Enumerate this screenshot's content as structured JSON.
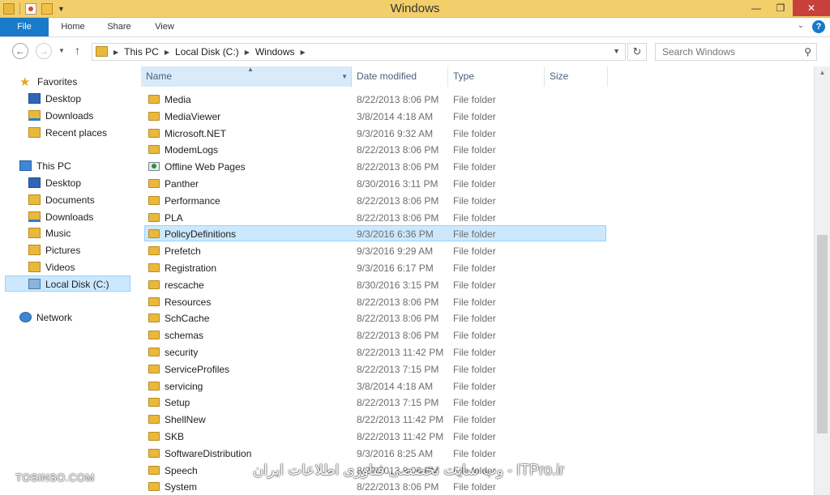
{
  "window": {
    "title": "Windows",
    "controls": {
      "minimize": "—",
      "restore": "❐",
      "close": "✕"
    }
  },
  "ribbon": {
    "tabs": [
      {
        "label": "File"
      },
      {
        "label": "Home"
      },
      {
        "label": "Share"
      },
      {
        "label": "View"
      }
    ],
    "expand_glyph": "⌄",
    "help_glyph": "?"
  },
  "address": {
    "breadcrumbs": [
      "This PC",
      "Local Disk (C:)",
      "Windows"
    ],
    "search_placeholder": "Search Windows"
  },
  "navigation": {
    "favorites": {
      "label": "Favorites",
      "items": [
        {
          "label": "Desktop",
          "icon": "desktop-icon"
        },
        {
          "label": "Downloads",
          "icon": "downloads-icon"
        },
        {
          "label": "Recent places",
          "icon": "recent-places-icon"
        }
      ]
    },
    "this_pc": {
      "label": "This PC",
      "items": [
        {
          "label": "Desktop",
          "icon": "desktop-icon"
        },
        {
          "label": "Documents",
          "icon": "documents-icon"
        },
        {
          "label": "Downloads",
          "icon": "downloads-icon"
        },
        {
          "label": "Music",
          "icon": "music-icon"
        },
        {
          "label": "Pictures",
          "icon": "pictures-icon"
        },
        {
          "label": "Videos",
          "icon": "videos-icon"
        },
        {
          "label": "Local Disk (C:)",
          "icon": "local-disk-icon",
          "selected": true
        }
      ]
    },
    "network": {
      "label": "Network"
    }
  },
  "columns": {
    "name": "Name",
    "date": "Date modified",
    "type": "Type",
    "size": "Size"
  },
  "files": [
    {
      "name": "Media",
      "date": "8/22/2013 8:06 PM",
      "type": "File folder"
    },
    {
      "name": "MediaViewer",
      "date": "3/8/2014 4:18 AM",
      "type": "File folder"
    },
    {
      "name": "Microsoft.NET",
      "date": "9/3/2016 9:32 AM",
      "type": "File folder"
    },
    {
      "name": "ModemLogs",
      "date": "8/22/2013 8:06 PM",
      "type": "File folder"
    },
    {
      "name": "Offline Web Pages",
      "date": "8/22/2013 8:06 PM",
      "type": "File folder",
      "special": true
    },
    {
      "name": "Panther",
      "date": "8/30/2016 3:11 PM",
      "type": "File folder"
    },
    {
      "name": "Performance",
      "date": "8/22/2013 8:06 PM",
      "type": "File folder"
    },
    {
      "name": "PLA",
      "date": "8/22/2013 8:06 PM",
      "type": "File folder"
    },
    {
      "name": "PolicyDefinitions",
      "date": "9/3/2016 6:36 PM",
      "type": "File folder",
      "selected": true
    },
    {
      "name": "Prefetch",
      "date": "9/3/2016 9:29 AM",
      "type": "File folder"
    },
    {
      "name": "Registration",
      "date": "9/3/2016 6:17 PM",
      "type": "File folder"
    },
    {
      "name": "rescache",
      "date": "8/30/2016 3:15 PM",
      "type": "File folder"
    },
    {
      "name": "Resources",
      "date": "8/22/2013 8:06 PM",
      "type": "File folder"
    },
    {
      "name": "SchCache",
      "date": "8/22/2013 8:06 PM",
      "type": "File folder"
    },
    {
      "name": "schemas",
      "date": "8/22/2013 8:06 PM",
      "type": "File folder"
    },
    {
      "name": "security",
      "date": "8/22/2013 11:42 PM",
      "type": "File folder"
    },
    {
      "name": "ServiceProfiles",
      "date": "8/22/2013 7:15 PM",
      "type": "File folder"
    },
    {
      "name": "servicing",
      "date": "3/8/2014 4:18 AM",
      "type": "File folder"
    },
    {
      "name": "Setup",
      "date": "8/22/2013 7:15 PM",
      "type": "File folder"
    },
    {
      "name": "ShellNew",
      "date": "8/22/2013 11:42 PM",
      "type": "File folder"
    },
    {
      "name": "SKB",
      "date": "8/22/2013 11:42 PM",
      "type": "File folder"
    },
    {
      "name": "SoftwareDistribution",
      "date": "9/3/2016 8:25 AM",
      "type": "File folder"
    },
    {
      "name": "Speech",
      "date": "8/22/2013 8:06 PM",
      "type": "File folder"
    },
    {
      "name": "System",
      "date": "8/22/2013 8:06 PM",
      "type": "File folder"
    }
  ],
  "watermark": {
    "left": "TOSINSO.COM",
    "right": "وب سایت تخصصی فناوری اطلاعات ایران - ITPro.ir"
  },
  "colors": {
    "titlebar": "#f3cf6b",
    "file_tab": "#1979ca",
    "selection": "#cce8ff",
    "selection_border": "#99d1ff",
    "close_button": "#c7403b"
  }
}
